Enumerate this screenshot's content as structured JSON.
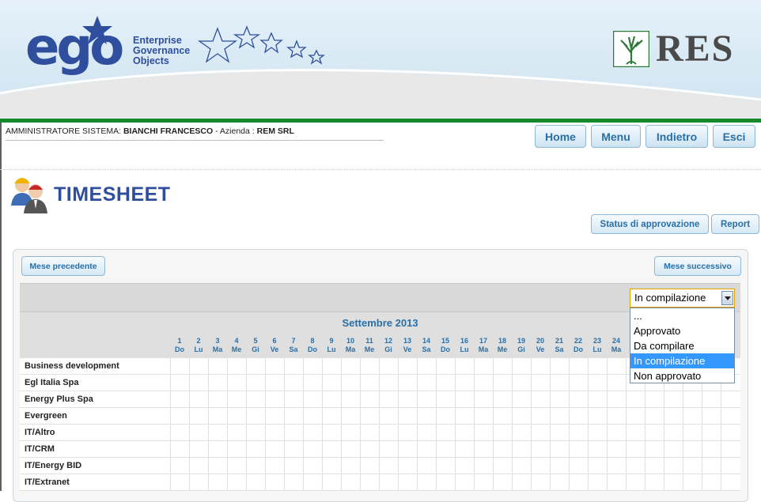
{
  "brand": {
    "logo_text": "ego",
    "logo_sub": [
      "Enterprise",
      "Governance",
      "Objects"
    ],
    "partner_logo_text": "RES",
    "brand_blue": "#2f4f9e",
    "green_bar": "#168a2b"
  },
  "user": {
    "role_label": "AMMINISTRATORE SISTEMA:",
    "name": "BIANCHI FRANCESCO",
    "company_sep": "- Azienda :",
    "company": "REM SRL"
  },
  "nav": {
    "home": "Home",
    "menu": "Menu",
    "back": "Indietro",
    "exit": "Esci"
  },
  "page": {
    "title": "TIMESHEET",
    "approval_status_button": "Status di approvazione",
    "report_button": "Report",
    "prev_month_button": "Mese precedente",
    "next_month_button": "Mese successivo"
  },
  "status_select": {
    "value": "In compilazione",
    "options": [
      "...",
      "Approvato",
      "Da compilare",
      "In compilazione",
      "Non approvato"
    ],
    "selected_index": 3
  },
  "calendar": {
    "month": "Settembre 2013",
    "days": [
      {
        "n": "1",
        "d": "Do"
      },
      {
        "n": "2",
        "d": "Lu"
      },
      {
        "n": "3",
        "d": "Ma"
      },
      {
        "n": "4",
        "d": "Me"
      },
      {
        "n": "5",
        "d": "Gi"
      },
      {
        "n": "6",
        "d": "Ve"
      },
      {
        "n": "7",
        "d": "Sa"
      },
      {
        "n": "8",
        "d": "Do"
      },
      {
        "n": "9",
        "d": "Lu"
      },
      {
        "n": "10",
        "d": "Ma"
      },
      {
        "n": "11",
        "d": "Me"
      },
      {
        "n": "12",
        "d": "Gi"
      },
      {
        "n": "13",
        "d": "Ve"
      },
      {
        "n": "14",
        "d": "Sa"
      },
      {
        "n": "15",
        "d": "Do"
      },
      {
        "n": "16",
        "d": "Lu"
      },
      {
        "n": "17",
        "d": "Ma"
      },
      {
        "n": "18",
        "d": "Me"
      },
      {
        "n": "19",
        "d": "Gi"
      },
      {
        "n": "20",
        "d": "Ve"
      },
      {
        "n": "21",
        "d": "Sa"
      },
      {
        "n": "22",
        "d": "Do"
      },
      {
        "n": "23",
        "d": "Lu"
      },
      {
        "n": "24",
        "d": "Ma"
      }
    ],
    "projects": [
      "Business development",
      "Egl Italia Spa",
      "Energy Plus Spa",
      "Evergreen",
      "IT/Altro",
      "IT/CRM",
      "IT/Energy BID",
      "IT/Extranet"
    ]
  }
}
